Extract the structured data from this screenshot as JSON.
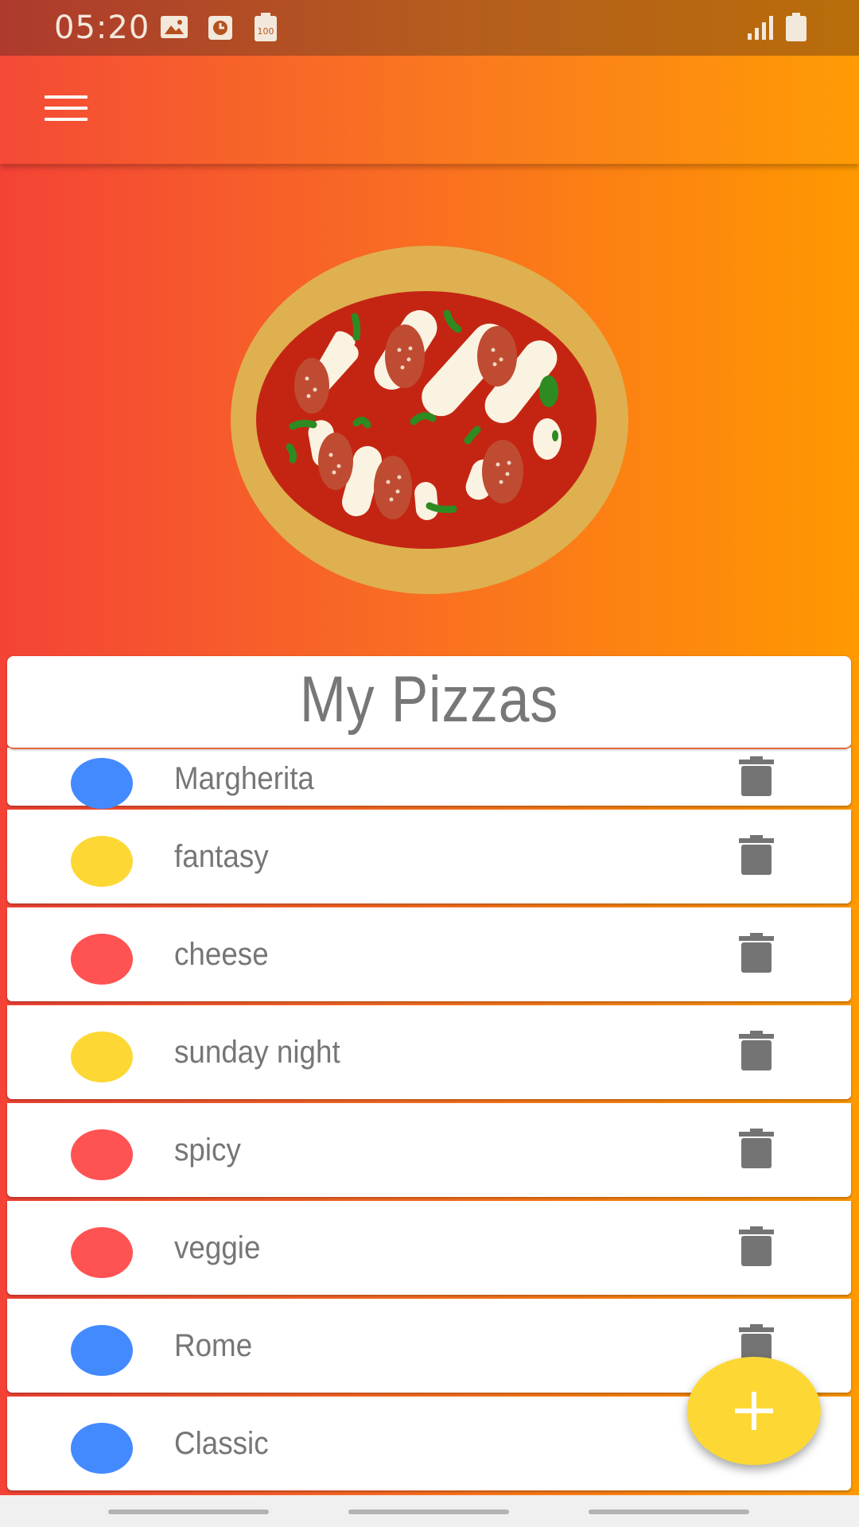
{
  "status_bar": {
    "time": "05:20",
    "battery_saver_label": "100",
    "icons": [
      "image-icon",
      "clock-icon",
      "battery-saver-icon",
      "signal-icon",
      "battery-icon"
    ]
  },
  "app_bar": {
    "menu_icon": "menu-icon"
  },
  "header": {
    "title": "My Pizzas"
  },
  "pizzas": [
    {
      "name": "Margherita",
      "color": "#448aff"
    },
    {
      "name": "fantasy",
      "color": "#fdd835"
    },
    {
      "name": "cheese",
      "color": "#ff5252"
    },
    {
      "name": "sunday night",
      "color": "#fdd835"
    },
    {
      "name": "spicy",
      "color": "#ff5252"
    },
    {
      "name": "veggie",
      "color": "#ff5252"
    },
    {
      "name": "Rome",
      "color": "#448aff"
    },
    {
      "name": "Classic",
      "color": "#448aff"
    }
  ],
  "fab": {
    "icon": "plus-icon"
  },
  "colors": {
    "gradient_start": "#f44336",
    "gradient_end": "#ff9900",
    "fab": "#fdd835"
  }
}
